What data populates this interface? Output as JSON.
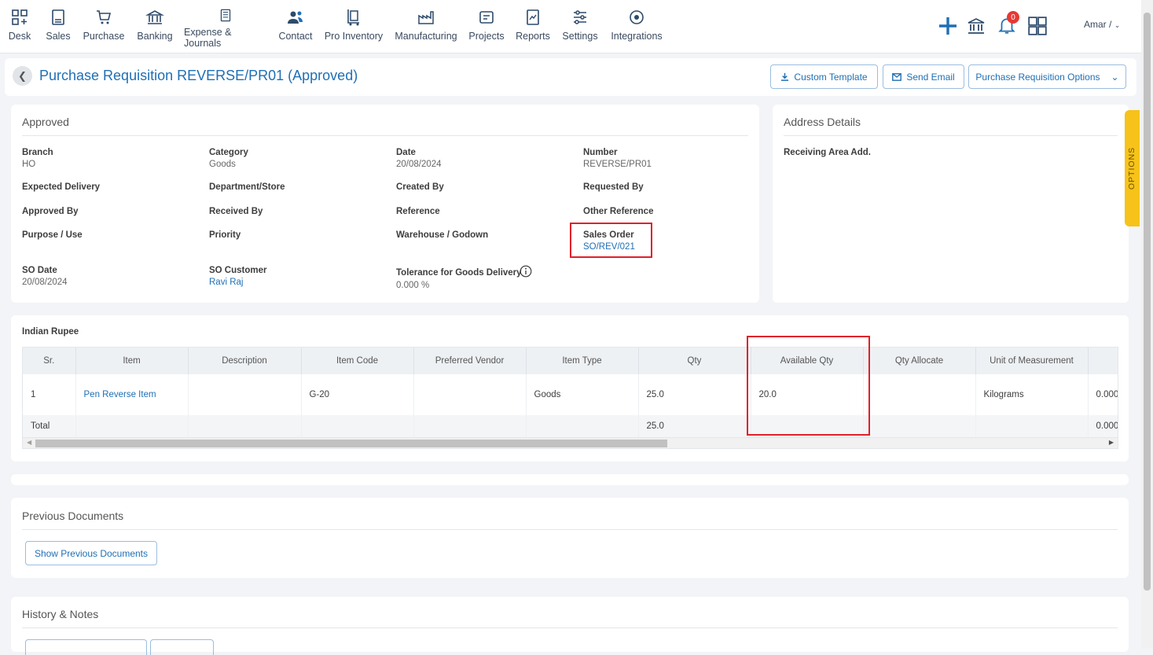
{
  "nav": {
    "items": [
      {
        "label": "Desk",
        "icon": "desk-grid-icon"
      },
      {
        "label": "Sales",
        "icon": "sales-document-icon"
      },
      {
        "label": "Purchase",
        "icon": "shopping-cart-icon"
      },
      {
        "label": "Banking",
        "icon": "bank-icon"
      },
      {
        "label": "Expense & Journals",
        "icon": "journal-book-icon"
      },
      {
        "label": "Contact",
        "icon": "contacts-people-icon"
      },
      {
        "label": "Pro Inventory",
        "icon": "inventory-trolley-icon"
      },
      {
        "label": "Manufacturing",
        "icon": "factory-icon"
      },
      {
        "label": "Projects",
        "icon": "projects-icon"
      },
      {
        "label": "Reports",
        "icon": "reports-chart-icon"
      },
      {
        "label": "Settings",
        "icon": "settings-sliders-icon"
      },
      {
        "label": "Integrations",
        "icon": "integrations-icon"
      }
    ],
    "notification_count": "0",
    "user_name": "Amar /"
  },
  "header": {
    "title": "Purchase Requisition REVERSE/PR01 (Approved)",
    "custom_template": "Custom Template",
    "send_email": "Send Email",
    "options": "Purchase Requisition Options"
  },
  "details": {
    "section_title": "Approved",
    "branch_label": "Branch",
    "branch_value": "HO",
    "category_label": "Category",
    "category_value": "Goods",
    "date_label": "Date",
    "date_value": "20/08/2024",
    "number_label": "Number",
    "number_value": "REVERSE/PR01",
    "expected_delivery": "Expected Delivery",
    "department": "Department/Store",
    "created_by": "Created By",
    "requested_by": "Requested By",
    "approved_by": "Approved By",
    "received_by": "Received By",
    "reference": "Reference",
    "other_reference": "Other Reference",
    "purpose": "Purpose / Use",
    "priority": "Priority",
    "warehouse": "Warehouse / Godown",
    "sales_order_label": "Sales Order",
    "sales_order_value": "SO/REV/021",
    "so_date_label": "SO Date",
    "so_date_value": "20/08/2024",
    "so_customer_label": "SO Customer",
    "so_customer_value": "Ravi Raj",
    "tolerance_label": "Tolerance for Goods Delivery",
    "tolerance_value": "0.000 %"
  },
  "address": {
    "section_title": "Address Details",
    "receiving_area": "Receiving Area Add."
  },
  "options_tab": "OPTIONS",
  "items_table": {
    "currency": "Indian Rupee",
    "columns": [
      "Sr.",
      "Item",
      "Description",
      "Item Code",
      "Preferred Vendor",
      "Item Type",
      "Qty",
      "Available Qty",
      "Qty Allocate",
      "Unit of Measurement",
      ""
    ],
    "row": {
      "sr": "1",
      "item": "Pen Reverse Item",
      "description": "",
      "item_code": "G-20",
      "vendor": "",
      "item_type": "Goods",
      "qty": "25.0",
      "available_qty": "20.0",
      "qty_allocate": "",
      "uom": "Kilograms",
      "extra": "0.000"
    },
    "total": {
      "label": "Total",
      "qty": "25.0",
      "extra": "0.000"
    }
  },
  "previous_documents": {
    "section_title": "Previous Documents",
    "button": "Show Previous Documents"
  },
  "history": {
    "section_title": "History & Notes"
  }
}
